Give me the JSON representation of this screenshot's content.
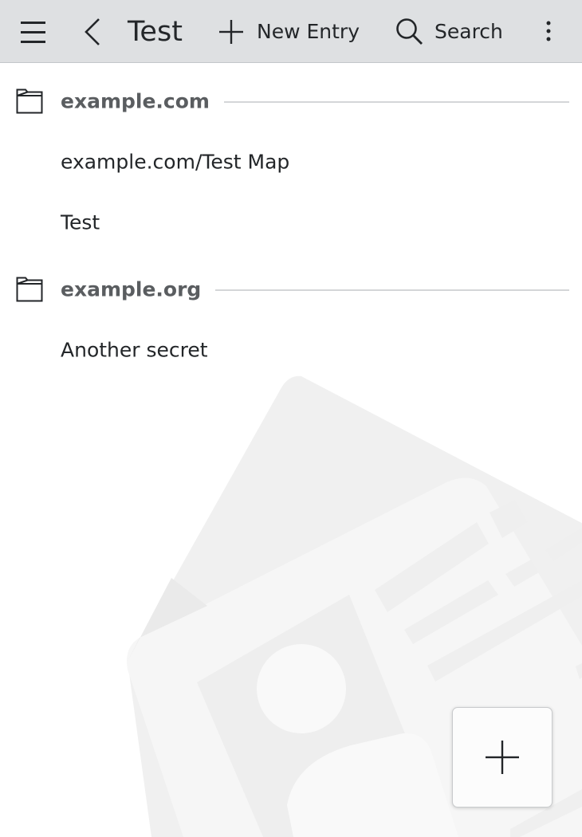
{
  "toolbar": {
    "menu_icon": "hamburger-menu-icon",
    "back_icon": "chevron-left-icon",
    "title": "Test",
    "new_entry": {
      "icon": "plus-icon",
      "label": "New Entry"
    },
    "search": {
      "icon": "search-icon",
      "label": "Search"
    },
    "overflow_icon": "vertical-ellipsis-icon"
  },
  "groups": [
    {
      "icon": "folder-icon",
      "title": "example.com",
      "entries": [
        {
          "label": "example.com/Test Map"
        },
        {
          "label": "Test"
        }
      ]
    },
    {
      "icon": "folder-icon",
      "title": "example.org",
      "entries": [
        {
          "label": "Another secret"
        }
      ]
    }
  ],
  "fab": {
    "icon": "plus-icon"
  },
  "background": {
    "icon": "id-card-illustration"
  },
  "colors": {
    "toolbar_bg": "#dee0e2",
    "text": "#232629",
    "section_text": "#5a5d60",
    "divider": "#d4d6d8",
    "page_bg": "#ffffff"
  }
}
